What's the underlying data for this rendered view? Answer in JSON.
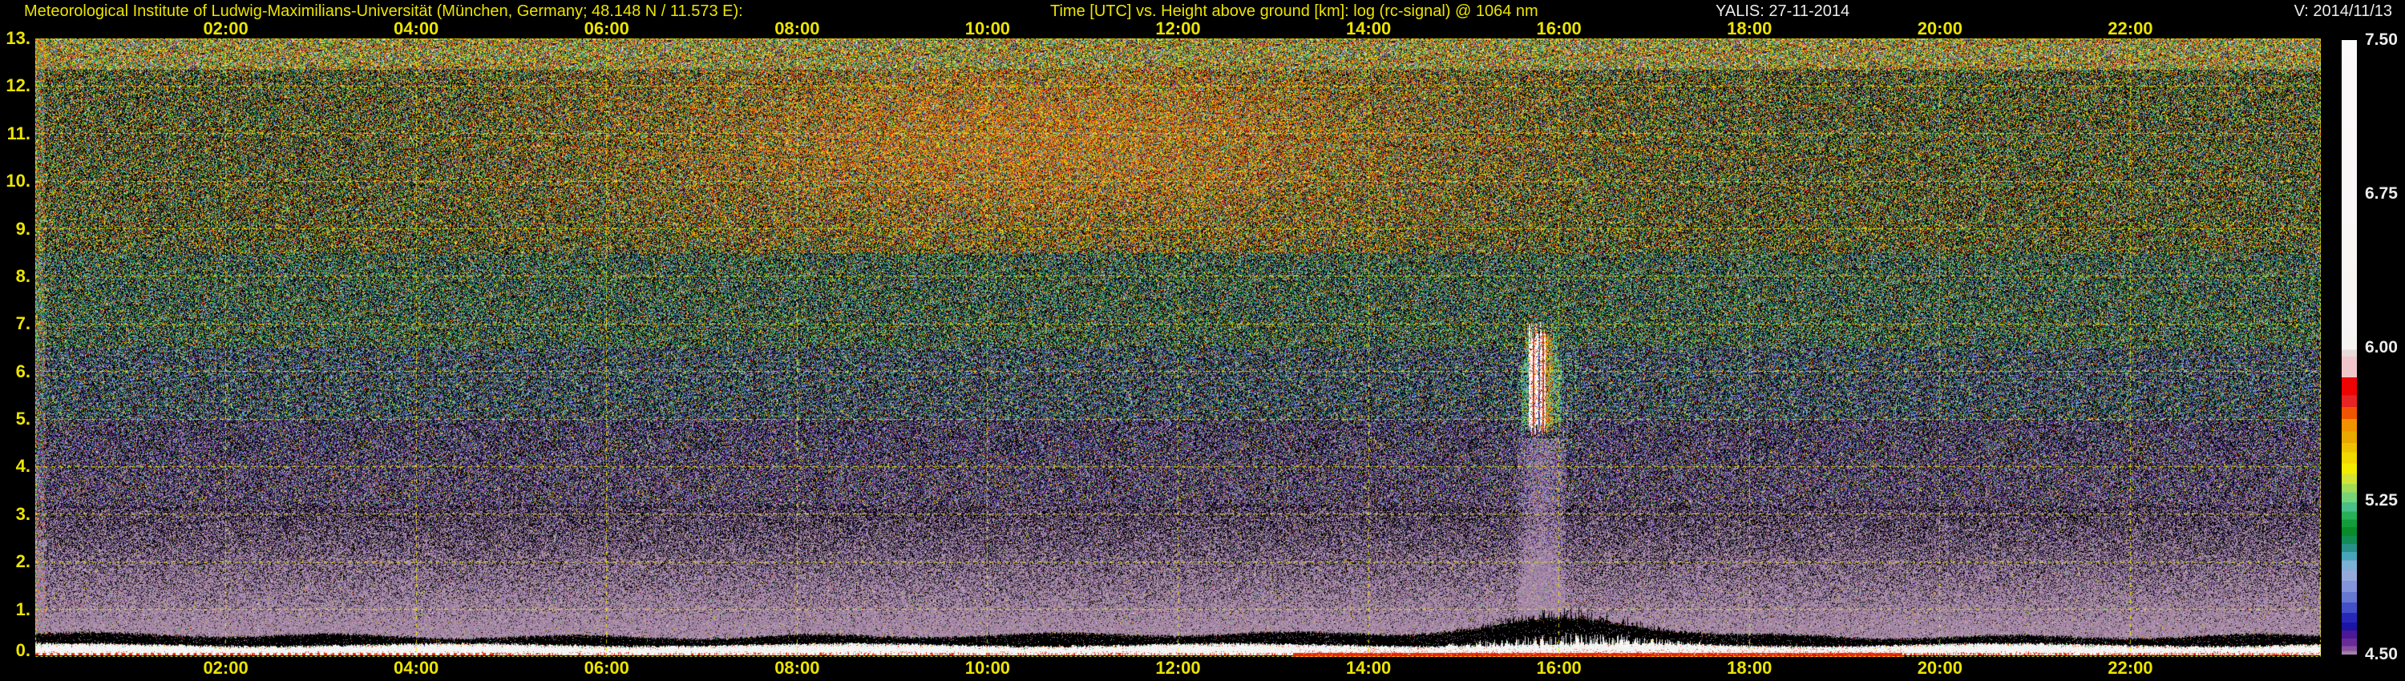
{
  "header": {
    "institute": "Meteorological Institute of Ludwig-Maximilians-Universität (München, Germany; 48.148 N / 11.573 E):",
    "plot_title": "Time [UTC] vs. Height above ground [km]: log (rc-signal) @ 1064 nm",
    "instrument_date": "YALIS: 27-11-2014",
    "version": "V: 2014/11/13"
  },
  "colors": {
    "background": "#000000",
    "axis_yellow": "#ece400",
    "grid_yellow": "#f2ea00",
    "label_white": "#ececec",
    "surface_red": "#d81e06",
    "low_level_mauve": "#a88ca8"
  },
  "chart_data": {
    "type": "heatmap",
    "title": "Time [UTC] vs. Height above ground [km]: log (rc-signal) @ 1064 nm",
    "station": "Meteorological Institute of Ludwig-Maximilians-Universität (München, Germany; 48.148 N / 11.573 E)",
    "instrument": "YALIS",
    "date": "27-11-2014",
    "version": "2014/11/13",
    "xlabel": "Time [UTC]",
    "ylabel": "Height above ground [km]",
    "zlabel": "log (rc-signal) @ 1064 nm",
    "x_range_hours": [
      0,
      24
    ],
    "x_tick_hours": [
      2,
      4,
      6,
      8,
      10,
      12,
      14,
      16,
      18,
      20,
      22
    ],
    "x_tick_labels": [
      "02:00",
      "04:00",
      "06:00",
      "08:00",
      "10:00",
      "12:00",
      "14:00",
      "16:00",
      "18:00",
      "20:00",
      "22:00"
    ],
    "x_ticks_shown_top_and_bottom": true,
    "y_range_km": [
      0,
      13
    ],
    "y_tick_km": [
      13,
      12,
      11,
      10,
      9,
      8,
      7,
      6,
      5,
      4,
      3,
      2,
      1,
      0
    ],
    "y_tick_labels": [
      "13.",
      "12.",
      "11.",
      "10.",
      "9.",
      "8.",
      "7.",
      "6.",
      "5.",
      "4.",
      "3.",
      "2.",
      "1.",
      "0."
    ],
    "grid": "yellow dashed lines every 2 h and every 1 km",
    "colorbar": {
      "min": 4.5,
      "max": 7.5,
      "tick_values": [
        7.5,
        6.75,
        6.0,
        5.25,
        4.5
      ],
      "tick_labels": [
        "7.50",
        "6.75",
        "6.00",
        "5.25",
        "4.50"
      ],
      "position": "right"
    },
    "features": [
      {
        "name": "cloud-echo",
        "time_utc": [
          "15:40",
          "15:55"
        ],
        "height_km": [
          4.5,
          7.1
        ],
        "description": "isolated strong cloud echo: white saturated core with red/orange edges and green-cyan fringes"
      },
      {
        "name": "virga-shaft",
        "time_utc": [
          "15:40",
          "16:00"
        ],
        "height_km": [
          0.8,
          4.5
        ],
        "description": "smooth enhanced-signal column below the cloud echo"
      },
      {
        "name": "boundary-layer-top",
        "time_utc": [
          "00:00",
          "24:00"
        ],
        "height_km": [
          0.35,
          0.8
        ],
        "description": "black band above the near-ground return; lifted and spiky ~15:00-17:00"
      },
      {
        "name": "near-ground-return",
        "time_utc": [
          "00:00",
          "24:00"
        ],
        "height_km": [
          0.05,
          0.3
        ],
        "description": "saturated white band along the surface"
      },
      {
        "name": "surface-red-line",
        "time_utc": [
          "00:00",
          "24:00"
        ],
        "height_km": [
          0.0,
          0.05
        ],
        "description": "red line at ground: dotted before ~13:00, solid ~13:00-19:30, intermittent after"
      },
      {
        "name": "noise-field",
        "time_utc": [
          "00:00",
          "24:00"
        ],
        "height_km": [
          1.0,
          13.0
        ],
        "description": "uncalibrated speckle noise: dense multicolour at 12-13 km, warm brownish haze 06:00-15:00 above 8 km, green-teal 5-9 km, blue-violet 3-6 km, mauve below 3 km"
      }
    ]
  }
}
